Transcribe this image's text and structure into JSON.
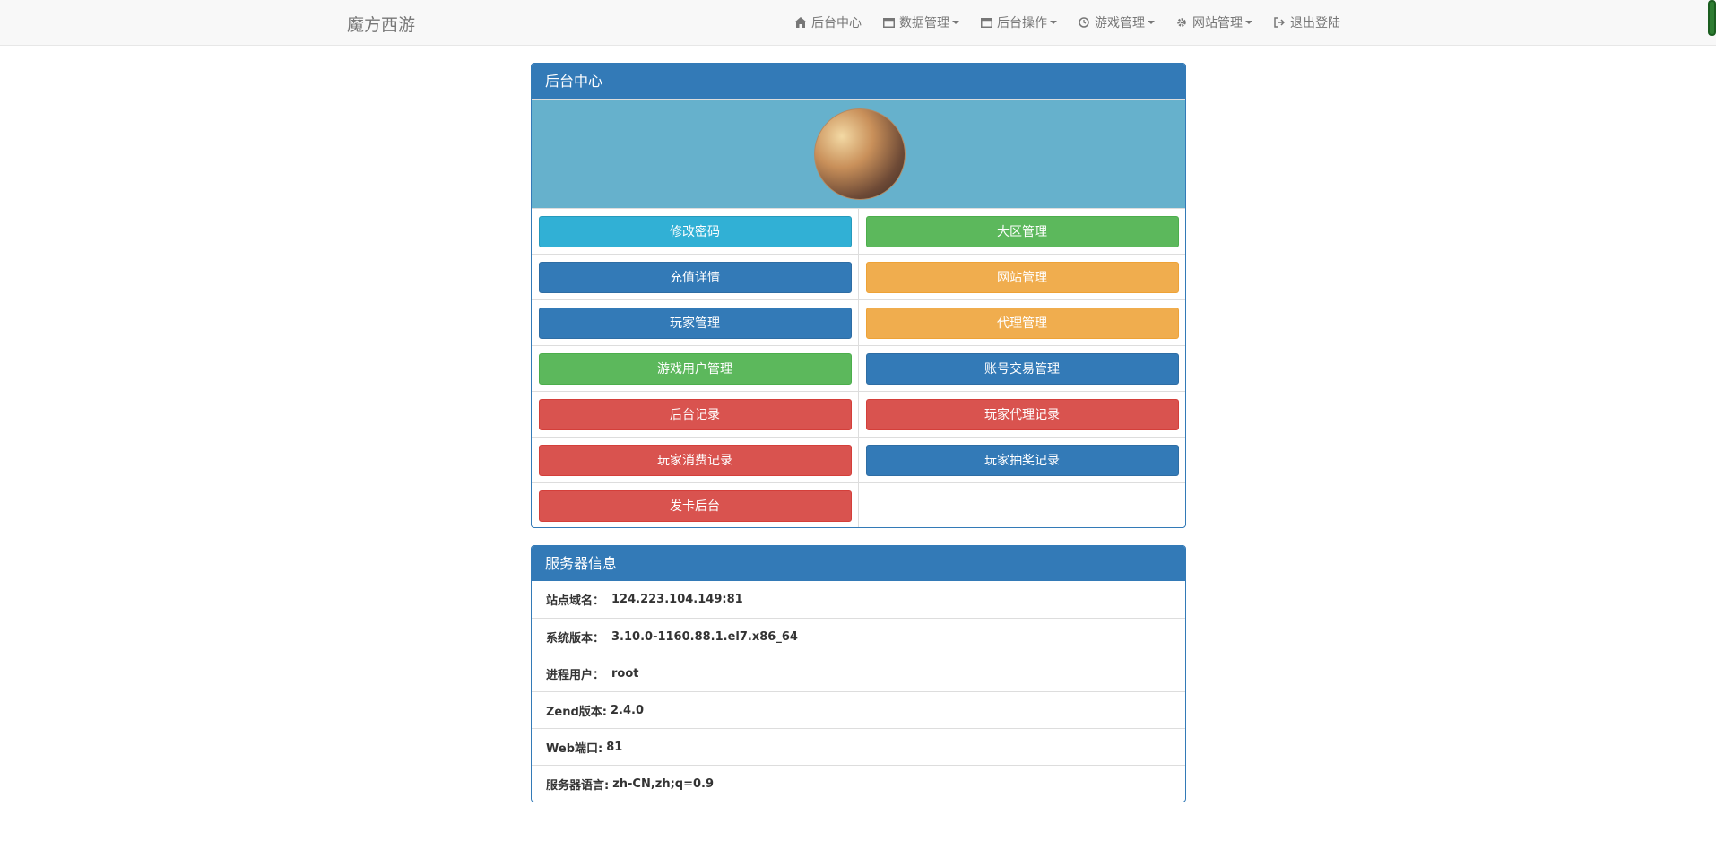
{
  "navbar": {
    "brand": "魔方西游",
    "items": [
      {
        "label": "后台中心",
        "icon": "home-icon",
        "dropdown": false
      },
      {
        "label": "数据管理",
        "icon": "window-icon",
        "dropdown": true
      },
      {
        "label": "后台操作",
        "icon": "window-icon",
        "dropdown": true
      },
      {
        "label": "游戏管理",
        "icon": "clock-icon",
        "dropdown": true
      },
      {
        "label": "网站管理",
        "icon": "gear-icon",
        "dropdown": true
      },
      {
        "label": "退出登陆",
        "icon": "logout-icon",
        "dropdown": false
      }
    ]
  },
  "admin_panel": {
    "title": "后台中心",
    "avatar": "user-avatar-photo",
    "buttons": [
      {
        "label": "修改密码",
        "style": "info"
      },
      {
        "label": "大区管理",
        "style": "success"
      },
      {
        "label": "充值详情",
        "style": "primary"
      },
      {
        "label": "网站管理",
        "style": "warning"
      },
      {
        "label": "玩家管理",
        "style": "primary"
      },
      {
        "label": "代理管理",
        "style": "warning"
      },
      {
        "label": "游戏用户管理",
        "style": "success"
      },
      {
        "label": "账号交易管理",
        "style": "primary"
      },
      {
        "label": "后台记录",
        "style": "danger"
      },
      {
        "label": "玩家代理记录",
        "style": "danger"
      },
      {
        "label": "玩家消费记录",
        "style": "danger"
      },
      {
        "label": "玩家抽奖记录",
        "style": "primary"
      },
      {
        "label": "发卡后台",
        "style": "danger"
      }
    ]
  },
  "server_panel": {
    "title": "服务器信息",
    "rows": [
      {
        "label": "站点域名：",
        "value": "124.223.104.149:81"
      },
      {
        "label": "系统版本：",
        "value": "3.10.0-1160.88.1.el7.x86_64"
      },
      {
        "label": "进程用户：",
        "value": "root"
      },
      {
        "label": "Zend版本:",
        "value": "2.4.0"
      },
      {
        "label": "Web端口:",
        "value": "81"
      },
      {
        "label": "服务器语言:",
        "value": "zh-CN,zh;q=0.9"
      }
    ]
  },
  "colors": {
    "primary": "#337ab7",
    "info": "#31b0d5",
    "success": "#5cb85c",
    "warning": "#f0ad4e",
    "danger": "#d9534f",
    "avatar_band": "#66b1cc"
  }
}
